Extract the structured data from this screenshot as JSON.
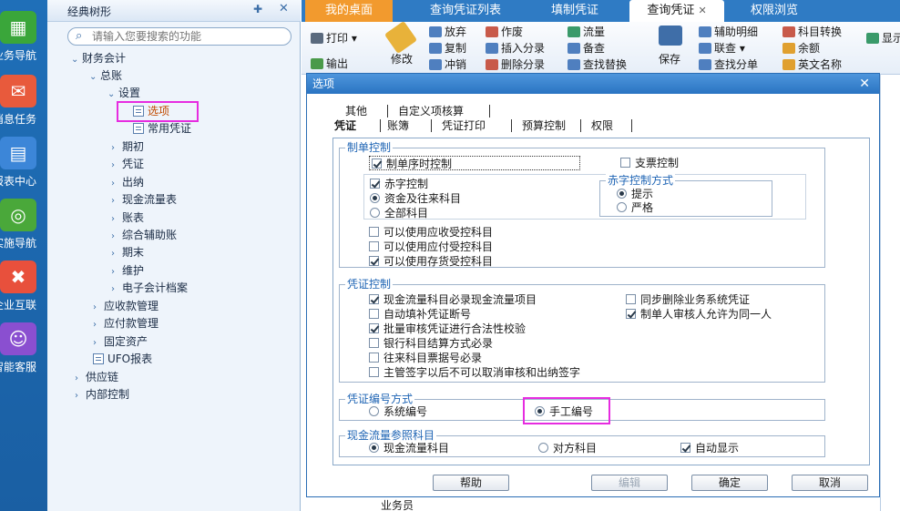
{
  "rail": {
    "items": [
      {
        "label": "业务导航",
        "icon": "grid-icon",
        "color": "#3aa63a"
      },
      {
        "label": "消息任务",
        "icon": "envelope-icon",
        "color": "#e85a3c"
      },
      {
        "label": "报表中心",
        "icon": "report-icon",
        "color": "#3c86d8"
      },
      {
        "label": "实施导航",
        "icon": "compass-icon",
        "color": "#4aa83a"
      },
      {
        "label": "企业互联",
        "icon": "link-icon",
        "color": "#e8503c"
      },
      {
        "label": "智能客服",
        "icon": "robot-icon",
        "color": "#8a4fd0"
      }
    ]
  },
  "tree": {
    "title": "经典树形",
    "search_placeholder": "请输入您要搜索的功能",
    "nodes": [
      "财务会计",
      "总账",
      "设置",
      "选项",
      "常用凭证",
      "期初",
      "凭证",
      "出纳",
      "现金流量表",
      "账表",
      "综合辅助账",
      "期末",
      "维护",
      "电子会计档案",
      "应收款管理",
      "应付款管理",
      "固定资产",
      "UFO报表",
      "供应链",
      "内部控制"
    ]
  },
  "tabs": [
    "我的桌面",
    "查询凭证列表",
    "填制凭证",
    "查询凭证",
    "权限浏览"
  ],
  "ribbon": {
    "print": "打印",
    "output": "输出",
    "modify": "修改",
    "abandon": "放弃",
    "copy": "复制",
    "offset": "冲销",
    "void": "作废",
    "insert_entry": "插入分录",
    "delete_entry": "删除分录",
    "flow": "流量",
    "memo": "备查",
    "find_replace": "查找替换",
    "save": "保存",
    "aux_detail": "辅助明细",
    "link_query": "联查",
    "find_entry": "查找分单",
    "subject_convert": "科目转换",
    "balance": "余额",
    "english_name": "英文名称",
    "show": "显示"
  },
  "dialog": {
    "title": "选项",
    "tabs_row1": [
      "其他",
      "自定义项核算"
    ],
    "tabs_row2": [
      "凭证",
      "账簿",
      "凭证打印",
      "预算控制",
      "权限"
    ],
    "group_entry": {
      "title": "制单控制",
      "serial_time": "制单序时控制",
      "cheque": "支票控制",
      "red_control": "赤字控制",
      "cash_account": "资金及往来科目",
      "all_account": "全部科目",
      "red_mode_title": "赤字控制方式",
      "prompt": "提示",
      "strict": "严格",
      "use_ar": "可以使用应收受控科目",
      "use_ap": "可以使用应付受控科目",
      "use_inv": "可以使用存货受控科目"
    },
    "group_voucher": {
      "title": "凭证控制",
      "cashflow_required": "现金流量科目必录现金流量项目",
      "sync_delete": "同步删除业务系统凭证",
      "auto_fill": "自动填补凭证断号",
      "same_person": "制单人审核人允许为同一人",
      "batch_check": "批量审核凭证进行合法性校验",
      "bank_settle": "银行科目结算方式必录",
      "ticket_no": "往来科目票据号必录",
      "supervisor": "主管签字以后不可以取消审核和出纳签字"
    },
    "group_numbering": {
      "title": "凭证编号方式",
      "system": "系统编号",
      "manual": "手工编号"
    },
    "group_cashflow": {
      "title": "现金流量参照科目",
      "cash_account": "现金流量科目",
      "contra": "对方科目",
      "auto_show": "自动显示"
    },
    "buttons": {
      "help": "帮助",
      "edit": "编辑",
      "ok": "确定",
      "cancel": "取消"
    }
  },
  "background": {
    "salesperson": "业务员"
  },
  "colors": {
    "accent": "#2f7bc4",
    "highlight": "#e62ce0",
    "orange_tab": "#f29a2e"
  }
}
